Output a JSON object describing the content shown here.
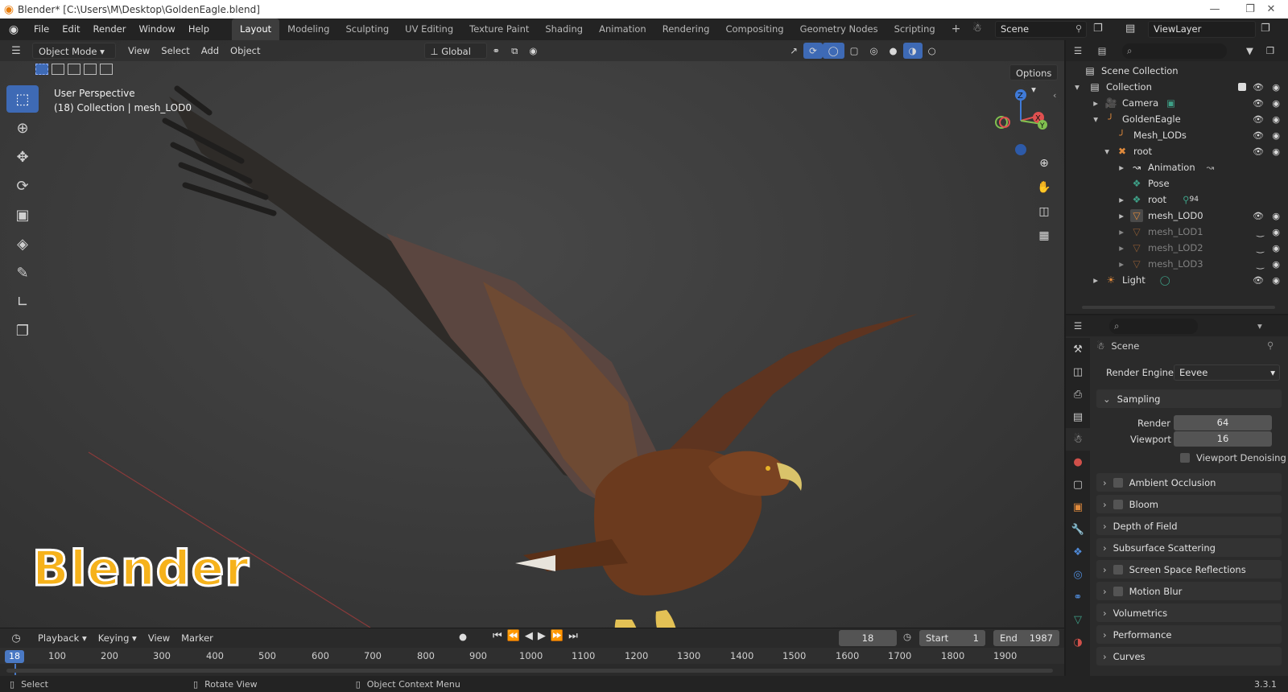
{
  "titlebar": {
    "title": "Blender* [C:\\Users\\M\\Desktop\\GoldenEagle.blend]"
  },
  "menu": [
    "File",
    "Edit",
    "Render",
    "Window",
    "Help"
  ],
  "workspaces": [
    "Layout",
    "Modeling",
    "Sculpting",
    "UV Editing",
    "Texture Paint",
    "Shading",
    "Animation",
    "Rendering",
    "Compositing",
    "Geometry Nodes",
    "Scripting"
  ],
  "scene": {
    "name": "Scene",
    "view_layer": "ViewLayer"
  },
  "viewport": {
    "mode": "Object Mode",
    "menus": [
      "View",
      "Select",
      "Add",
      "Object"
    ],
    "transform_orientation": "Global",
    "options_label": "Options",
    "perspective_label": "User Perspective",
    "collection_label": "(18) Collection | mesh_LOD0",
    "watermark": "Blender",
    "gizmo": {
      "z": "Z",
      "x": "X",
      "y": "Y"
    }
  },
  "outliner": {
    "rows": [
      {
        "label": "Scene Collection",
        "indent": 0,
        "icon": "scene-collection-icon",
        "dim": false
      },
      {
        "label": "Collection",
        "indent": 1,
        "icon": "collection-icon",
        "dim": false
      },
      {
        "label": "Camera",
        "indent": 2,
        "icon": "camera-icon",
        "dim": false
      },
      {
        "label": "GoldenEagle",
        "indent": 2,
        "icon": "armature-icon",
        "dim": false
      },
      {
        "label": "Mesh_LODs",
        "indent": 3,
        "icon": "armature-icon",
        "dim": false
      },
      {
        "label": "root",
        "indent": 3,
        "icon": "armature-icon",
        "dim": false
      },
      {
        "label": "Animation",
        "indent": 4,
        "icon": "animation-icon",
        "dim": false
      },
      {
        "label": "Pose",
        "indent": 4,
        "icon": "pose-icon",
        "dim": false
      },
      {
        "label": "root",
        "indent": 4,
        "icon": "bone-icon",
        "dim": false,
        "badge": "94"
      },
      {
        "label": "mesh_LOD0",
        "indent": 4,
        "icon": "mesh-icon",
        "dim": false
      },
      {
        "label": "mesh_LOD1",
        "indent": 4,
        "icon": "mesh-icon",
        "dim": true
      },
      {
        "label": "mesh_LOD2",
        "indent": 4,
        "icon": "mesh-icon",
        "dim": true
      },
      {
        "label": "mesh_LOD3",
        "indent": 4,
        "icon": "mesh-icon",
        "dim": true
      },
      {
        "label": "Light",
        "indent": 2,
        "icon": "light-icon",
        "dim": false
      }
    ]
  },
  "properties": {
    "context": "Scene",
    "render_engine_label": "Render Engine",
    "render_engine": "Eevee",
    "sampling": {
      "title": "Sampling",
      "render_label": "Render",
      "render_value": "64",
      "viewport_label": "Viewport",
      "viewport_value": "16",
      "denoise_label": "Viewport Denoising"
    },
    "panels": [
      {
        "label": "Ambient Occlusion",
        "checkbox": true
      },
      {
        "label": "Bloom",
        "checkbox": true
      },
      {
        "label": "Depth of Field",
        "checkbox": false
      },
      {
        "label": "Subsurface Scattering",
        "checkbox": false
      },
      {
        "label": "Screen Space Reflections",
        "checkbox": true
      },
      {
        "label": "Motion Blur",
        "checkbox": true
      },
      {
        "label": "Volumetrics",
        "checkbox": false
      },
      {
        "label": "Performance",
        "checkbox": false
      },
      {
        "label": "Curves",
        "checkbox": false
      }
    ]
  },
  "timeline": {
    "menus": [
      "Playback",
      "Keying",
      "View",
      "Marker"
    ],
    "current_frame": "18",
    "start_label": "Start",
    "start": "1",
    "end_label": "End",
    "end": "1987",
    "ruler": [
      "100",
      "200",
      "300",
      "400",
      "500",
      "600",
      "700",
      "800",
      "900",
      "1000",
      "1100",
      "1200",
      "1300",
      "1400",
      "1500",
      "1600",
      "1700",
      "1800",
      "1900"
    ],
    "playhead": "18"
  },
  "statusbar": {
    "select": "Select",
    "rotate": "Rotate View",
    "context": "Object Context Menu",
    "version": "3.3.1"
  }
}
